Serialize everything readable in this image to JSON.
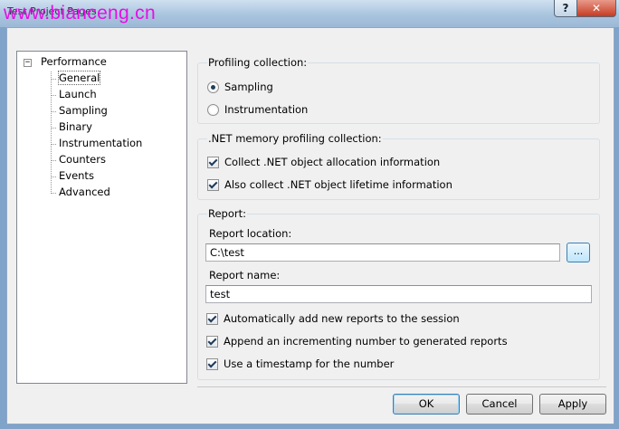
{
  "window": {
    "title": "Test Project Pages",
    "watermark": "www.bianceng.cn",
    "help_glyph": "?",
    "close_glyph": "✕"
  },
  "tree": {
    "expander_glyph": "−",
    "root": "Performance",
    "items": [
      "General",
      "Launch",
      "Sampling",
      "Binary",
      "Instrumentation",
      "Counters",
      "Events",
      "Advanced"
    ],
    "selected": "General"
  },
  "profiling": {
    "heading": "Profiling collection:",
    "sampling": "Sampling",
    "instrumentation": "Instrumentation",
    "selected": "Sampling"
  },
  "memory": {
    "heading": ".NET memory profiling collection:",
    "allocation": "Collect .NET object allocation information",
    "lifetime": "Also collect .NET object lifetime information",
    "allocation_checked": true,
    "lifetime_checked": true
  },
  "report": {
    "heading": "Report:",
    "location_label": "Report location:",
    "location_value": "C:\\test",
    "browse_label": "...",
    "name_label": "Report name:",
    "name_value": "test",
    "auto_add": "Automatically add new reports to the session",
    "append_number": "Append an incrementing number to generated reports",
    "timestamp": "Use a timestamp for the number",
    "auto_add_checked": true,
    "append_number_checked": true,
    "timestamp_checked": true
  },
  "buttons": {
    "ok": "OK",
    "cancel": "Cancel",
    "apply": "Apply"
  }
}
